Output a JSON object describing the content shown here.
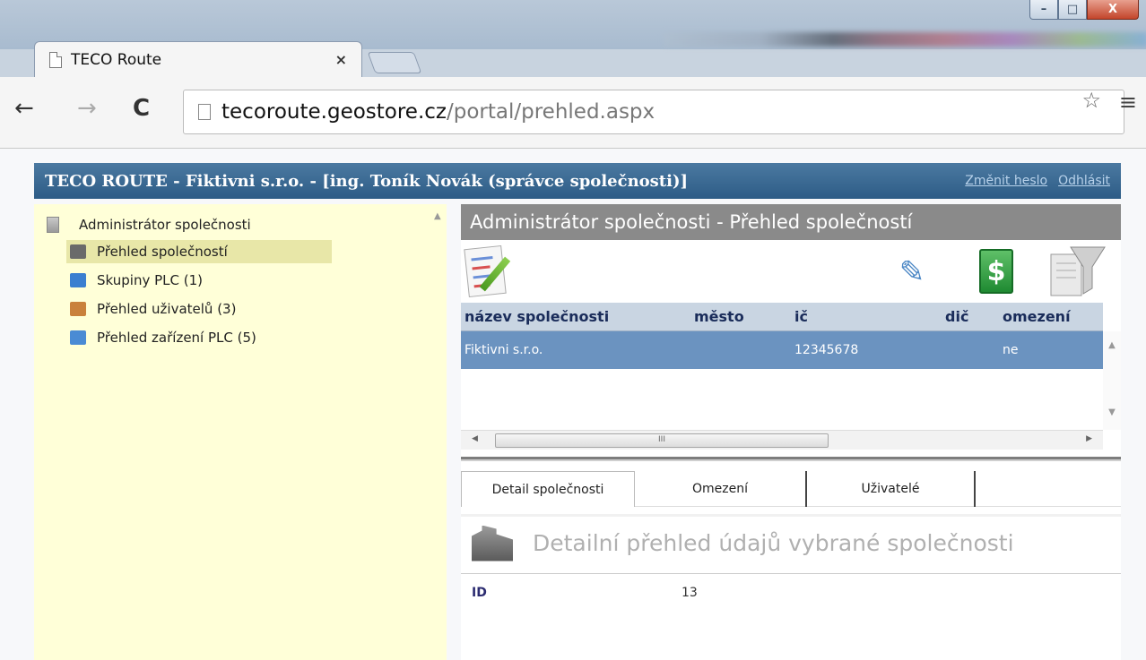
{
  "browser": {
    "tab_title": "TECO Route",
    "tab_close": "×",
    "url_host": "tecoroute.geostore.cz",
    "url_path": "/portal/prehled.aspx",
    "back": "←",
    "forward": "→",
    "reload": "C",
    "star": "☆",
    "menu": "≡",
    "win_min": "–",
    "win_max": "□",
    "win_close": "X"
  },
  "header": {
    "title": "TECO ROUTE - Fiktivni s.r.o. - [ing. Toník Novák (správce společnosti)]",
    "change_password": "Změnit heslo",
    "logout": "Odhlásit"
  },
  "sidebar": {
    "root": "Administrátor společnosti",
    "items": [
      {
        "label": "Přehled společností",
        "icon": "buildings-icon",
        "color": "#6a6a6a"
      },
      {
        "label": "Skupiny PLC (1)",
        "icon": "plc-group-icon",
        "color": "#3b7fd0"
      },
      {
        "label": "Přehled uživatelů (3)",
        "icon": "users-icon",
        "color": "#c9813c"
      },
      {
        "label": "Přehled zařízení PLC (5)",
        "icon": "devices-icon",
        "color": "#4a8bd4"
      }
    ]
  },
  "main": {
    "title": "Administrátor společnosti - Přehled společností",
    "columns": [
      "název společnosti",
      "město",
      "ič",
      "dič",
      "omezení"
    ],
    "rows": [
      {
        "name": "Fiktivni s.r.o.",
        "city": "",
        "ic": "12345678",
        "dic": "",
        "limit": "ne"
      }
    ],
    "hscroll_grip": "III",
    "tabs": [
      "Detail společnosti",
      "Omezení",
      "Uživatelé"
    ],
    "detail_title": "Detailní přehled údajů vybrané společnosti",
    "detail": {
      "id_label": "ID",
      "id_value": "13"
    }
  }
}
